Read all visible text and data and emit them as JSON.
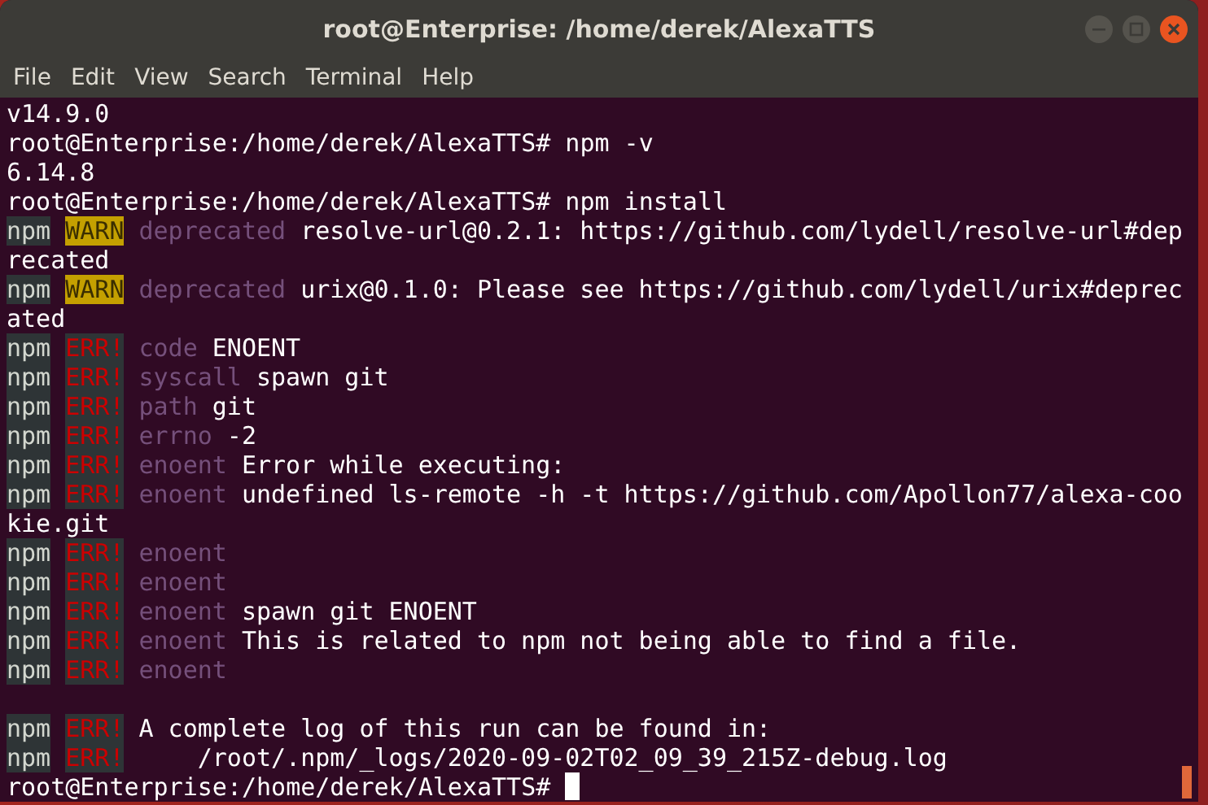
{
  "window": {
    "title": "root@Enterprise: /home/derek/AlexaTTS"
  },
  "menu": [
    "File",
    "Edit",
    "View",
    "Search",
    "Terminal",
    "Help"
  ],
  "terminal": {
    "lines": [
      {
        "segments": [
          {
            "kind": "plain",
            "text": "v14.9.0"
          }
        ]
      },
      {
        "segments": [
          {
            "kind": "plain",
            "text": "root@Enterprise:/home/derek/AlexaTTS# npm -v"
          }
        ]
      },
      {
        "segments": [
          {
            "kind": "plain",
            "text": "6.14.8"
          }
        ]
      },
      {
        "segments": [
          {
            "kind": "plain",
            "text": "root@Enterprise:/home/derek/AlexaTTS# npm install"
          }
        ]
      },
      {
        "segments": [
          {
            "kind": "npm",
            "text": "npm"
          },
          {
            "kind": "warn",
            "text": "WARN"
          },
          {
            "kind": "key",
            "text": "deprecated"
          },
          {
            "kind": "plain",
            "text": "resolve-url@0.2.1: https://github.com/lydell/resolve-url#dep"
          }
        ]
      },
      {
        "segments": [
          {
            "kind": "plain",
            "text": "recated"
          }
        ]
      },
      {
        "segments": [
          {
            "kind": "npm",
            "text": "npm"
          },
          {
            "kind": "warn",
            "text": "WARN"
          },
          {
            "kind": "key",
            "text": "deprecated"
          },
          {
            "kind": "plain",
            "text": "urix@0.1.0: Please see https://github.com/lydell/urix#deprec"
          }
        ]
      },
      {
        "segments": [
          {
            "kind": "plain",
            "text": "ated"
          }
        ]
      },
      {
        "segments": [
          {
            "kind": "npm",
            "text": "npm"
          },
          {
            "kind": "err",
            "text": "ERR!"
          },
          {
            "kind": "key",
            "text": "code"
          },
          {
            "kind": "plain",
            "text": "ENOENT"
          }
        ]
      },
      {
        "segments": [
          {
            "kind": "npm",
            "text": "npm"
          },
          {
            "kind": "err",
            "text": "ERR!"
          },
          {
            "kind": "key",
            "text": "syscall"
          },
          {
            "kind": "plain",
            "text": "spawn git"
          }
        ]
      },
      {
        "segments": [
          {
            "kind": "npm",
            "text": "npm"
          },
          {
            "kind": "err",
            "text": "ERR!"
          },
          {
            "kind": "key",
            "text": "path"
          },
          {
            "kind": "plain",
            "text": "git"
          }
        ]
      },
      {
        "segments": [
          {
            "kind": "npm",
            "text": "npm"
          },
          {
            "kind": "err",
            "text": "ERR!"
          },
          {
            "kind": "key",
            "text": "errno"
          },
          {
            "kind": "plain",
            "text": "-2"
          }
        ]
      },
      {
        "segments": [
          {
            "kind": "npm",
            "text": "npm"
          },
          {
            "kind": "err",
            "text": "ERR!"
          },
          {
            "kind": "key",
            "text": "enoent"
          },
          {
            "kind": "plain",
            "text": "Error while executing:"
          }
        ]
      },
      {
        "segments": [
          {
            "kind": "npm",
            "text": "npm"
          },
          {
            "kind": "err",
            "text": "ERR!"
          },
          {
            "kind": "key",
            "text": "enoent"
          },
          {
            "kind": "plain",
            "text": "undefined ls-remote -h -t https://github.com/Apollon77/alexa-coo"
          }
        ]
      },
      {
        "segments": [
          {
            "kind": "plain",
            "text": "kie.git"
          }
        ]
      },
      {
        "segments": [
          {
            "kind": "npm",
            "text": "npm"
          },
          {
            "kind": "err",
            "text": "ERR!"
          },
          {
            "kind": "key",
            "text": "enoent"
          }
        ]
      },
      {
        "segments": [
          {
            "kind": "npm",
            "text": "npm"
          },
          {
            "kind": "err",
            "text": "ERR!"
          },
          {
            "kind": "key",
            "text": "enoent"
          }
        ]
      },
      {
        "segments": [
          {
            "kind": "npm",
            "text": "npm"
          },
          {
            "kind": "err",
            "text": "ERR!"
          },
          {
            "kind": "key",
            "text": "enoent"
          },
          {
            "kind": "plain",
            "text": "spawn git ENOENT"
          }
        ]
      },
      {
        "segments": [
          {
            "kind": "npm",
            "text": "npm"
          },
          {
            "kind": "err",
            "text": "ERR!"
          },
          {
            "kind": "key",
            "text": "enoent"
          },
          {
            "kind": "plain",
            "text": "This is related to npm not being able to find a file."
          }
        ]
      },
      {
        "segments": [
          {
            "kind": "npm",
            "text": "npm"
          },
          {
            "kind": "err",
            "text": "ERR!"
          },
          {
            "kind": "key",
            "text": "enoent"
          }
        ]
      },
      {
        "blank_before": true,
        "segments": [
          {
            "kind": "npm",
            "text": "npm"
          },
          {
            "kind": "err",
            "text": "ERR!"
          },
          {
            "kind": "plain",
            "text": "A complete log of this run can be found in:"
          }
        ]
      },
      {
        "segments": [
          {
            "kind": "npm",
            "text": "npm"
          },
          {
            "kind": "err",
            "text": "ERR!"
          },
          {
            "kind": "plain",
            "text": "    /root/.npm/_logs/2020-09-02T02_09_39_215Z-debug.log"
          }
        ]
      },
      {
        "cursor": true,
        "segments": [
          {
            "kind": "plain",
            "text": "root@Enterprise:/home/derek/AlexaTTS#"
          }
        ]
      }
    ]
  }
}
